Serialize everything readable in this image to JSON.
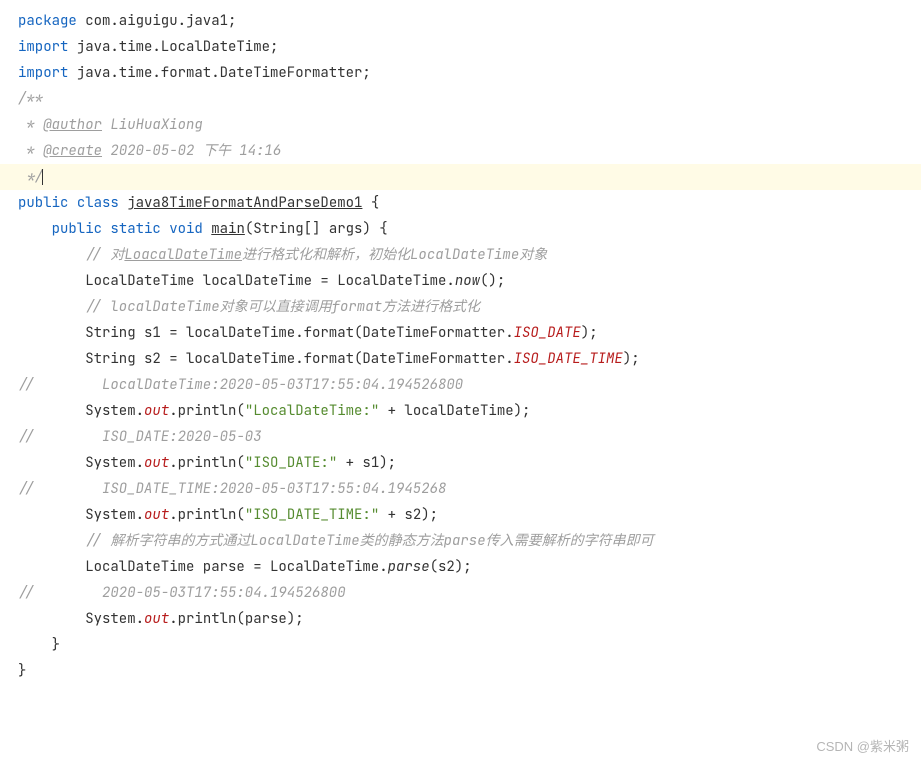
{
  "code": {
    "l1": {
      "kw": "package",
      "rest": " com.aiguigu.java1;"
    },
    "l2": "",
    "l3": {
      "kw": "import",
      "rest": " java.time.LocalDateTime;"
    },
    "l4": {
      "kw": "import",
      "rest": " java.time.format.DateTimeFormatter;"
    },
    "l5": "",
    "l6": "/**",
    "l7": {
      "pre": " * ",
      "tag": "@author",
      "rest": " LiuHuaXiong"
    },
    "l8": {
      "pre": " * ",
      "tag": "@create",
      "rest": " 2020-05-02 下午 14:16"
    },
    "l9": " */",
    "l10": {
      "kw1": "public",
      "sp1": " ",
      "kw2": "class",
      "sp2": " ",
      "cls": "java8TimeFormatAndParseDemo1",
      "rest": " {"
    },
    "l11": {
      "ind": "    ",
      "kw1": "public",
      "sp1": " ",
      "kw2": "static",
      "sp2": " ",
      "kw3": "void",
      "sp3": " ",
      "fn": "main",
      "rest": "(String[] args) {"
    },
    "l12": {
      "ind": "        ",
      "cm": "// 对",
      "u": "LoacalDateTime",
      "cm2": "进行格式化和解析，初始化LocalDateTime对象"
    },
    "l13": {
      "ind": "        ",
      "t1": "LocalDateTime localDateTime = LocalDateTime.",
      "it": "now",
      "t2": "();"
    },
    "l14": {
      "ind": "        ",
      "cm": "// localDateTime对象可以直接调用format方法进行格式化"
    },
    "l15": {
      "ind": "        ",
      "t1": "String s1 = localDateTime.format(DateTimeFormatter.",
      "stat": "ISO_DATE",
      "t2": ");"
    },
    "l16": {
      "ind": "        ",
      "t1": "String s2 = localDateTime.format(DateTimeFormatter.",
      "stat": "ISO_DATE_TIME",
      "t2": ");"
    },
    "l17": {
      "pre": "//        ",
      "cm": "LocalDateTime:2020-05-03T17:55:04.194526800"
    },
    "l18": {
      "ind": "        ",
      "t1": "System.",
      "stat": "out",
      "t2": ".println(",
      "str": "\"LocalDateTime:\"",
      "t3": " + localDateTime);"
    },
    "l19": {
      "pre": "//        ",
      "cm": "ISO_DATE:2020-05-03"
    },
    "l20": {
      "ind": "        ",
      "t1": "System.",
      "stat": "out",
      "t2": ".println(",
      "str": "\"ISO_DATE:\"",
      "t3": " + s1);"
    },
    "l21": {
      "pre": "//        ",
      "cm": "ISO_DATE_TIME:2020-05-03T17:55:04.1945268"
    },
    "l22": {
      "ind": "        ",
      "t1": "System.",
      "stat": "out",
      "t2": ".println(",
      "str": "\"ISO_DATE_TIME:\"",
      "t3": " + s2);"
    },
    "l23": {
      "ind": "        ",
      "cm": "// 解析字符串的方式通过LocalDateTime类的静态方法parse传入需要解析的字符串即可"
    },
    "l24": {
      "ind": "        ",
      "t1": "LocalDateTime parse = LocalDateTime.",
      "it": "parse",
      "t2": "(s2);"
    },
    "l25": {
      "pre": "//        ",
      "cm": "2020-05-03T17:55:04.194526800"
    },
    "l26": {
      "ind": "        ",
      "t1": "System.",
      "stat": "out",
      "t2": ".println(parse);"
    },
    "l27": "",
    "l28": "    }",
    "l29": "}"
  },
  "watermark": "CSDN @紫米粥"
}
